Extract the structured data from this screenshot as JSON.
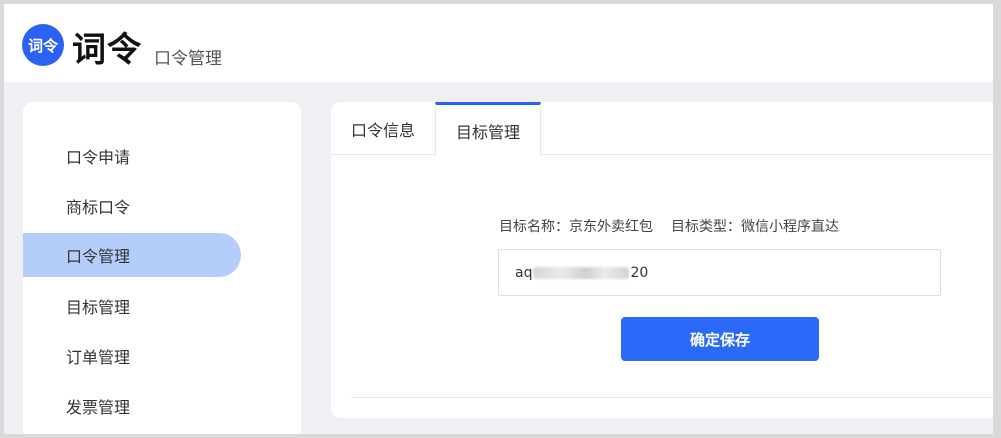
{
  "header": {
    "logo_text": "词令",
    "brand": "词令",
    "subtitle": "口令管理"
  },
  "sidebar": {
    "items": [
      {
        "label": "口令申请"
      },
      {
        "label": "商标口令"
      },
      {
        "label": "口令管理",
        "active": true
      },
      {
        "label": "目标管理"
      },
      {
        "label": "订单管理"
      },
      {
        "label": "发票管理"
      }
    ]
  },
  "tabs": [
    {
      "label": "口令信息"
    },
    {
      "label": "目标管理",
      "active": true
    }
  ],
  "target": {
    "name_label": "目标名称：",
    "name_value": "京东外卖红包",
    "type_label": "目标类型：",
    "type_value": "微信小程序直达"
  },
  "input": {
    "value_prefix": "aq",
    "value_suffix": "20"
  },
  "actions": {
    "save_label": "确定保存"
  },
  "colors": {
    "accent": "#2b6af8",
    "active_menu_bg": "#b5cdfb",
    "page_bg": "#eff0f4"
  }
}
